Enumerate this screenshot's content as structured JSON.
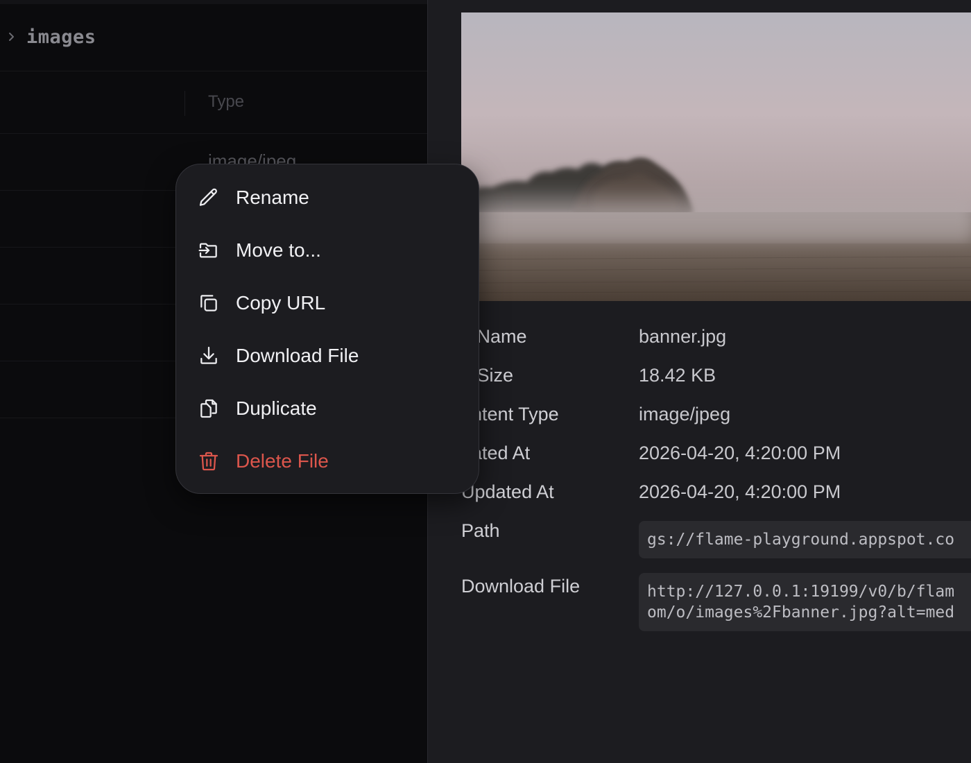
{
  "breadcrumb": {
    "folder": "images"
  },
  "table": {
    "columns": [
      "Type"
    ],
    "rows": [
      {
        "type": "image/jpeg"
      }
    ]
  },
  "context_menu": {
    "items": [
      {
        "label": "Rename",
        "icon": "pencil-icon"
      },
      {
        "label": "Move to...",
        "icon": "folder-move-icon"
      },
      {
        "label": "Copy URL",
        "icon": "copy-icon"
      },
      {
        "label": "Download File",
        "icon": "download-icon"
      },
      {
        "label": "Duplicate",
        "icon": "duplicate-icon"
      },
      {
        "label": "Delete File",
        "icon": "trash-icon",
        "danger": true
      }
    ]
  },
  "details": {
    "fields": [
      {
        "label": "e Name",
        "value": "banner.jpg"
      },
      {
        "label": "e Size",
        "value": "18.42 KB"
      },
      {
        "label": "ontent Type",
        "value": "image/jpeg"
      },
      {
        "label": "eated At",
        "value": "2026-04-20, 4:20:00 PM"
      },
      {
        "label": "Updated At",
        "value": "2026-04-20, 4:20:00 PM"
      }
    ],
    "path": {
      "label": "Path",
      "value": "gs://flame-playground.appspot.co"
    },
    "download": {
      "label": "Download File",
      "line1": "http://127.0.0.1:19199/v0/b/flam",
      "line2": "om/o/images%2Fbanner.jpg?alt=med"
    }
  },
  "colors": {
    "danger": "#dc564c",
    "menu_bg": "#1c1c20",
    "pane_bg": "#1c1c20",
    "page_bg": "#0b0b0d"
  }
}
